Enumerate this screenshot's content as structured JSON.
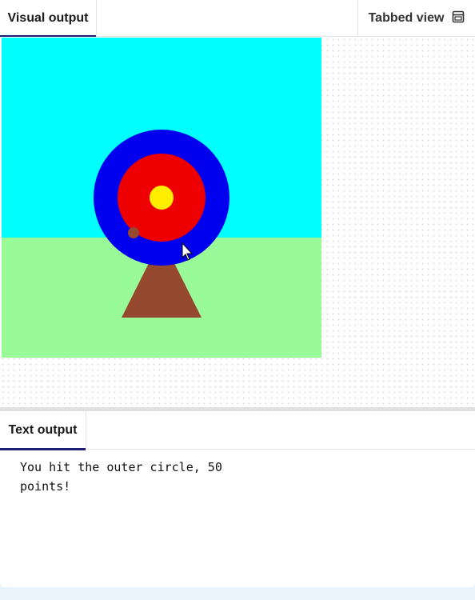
{
  "visual_panel": {
    "tab_label": "Visual output",
    "tabbed_view_label": "Tabbed view",
    "tabbed_view_icon": "window-icon"
  },
  "scene": {
    "sky_color": "#00ffff",
    "grass_color": "#98fb98",
    "stand_color": "#954a2f",
    "outer_ring_color": "#0000ee",
    "middle_ring_color": "#ee0000",
    "bullseye_color": "#ffee00",
    "arrow_hit_color": "#954a2f"
  },
  "text_panel": {
    "tab_label": "Text output",
    "output": "You hit the outer circle, 50\npoints!"
  }
}
